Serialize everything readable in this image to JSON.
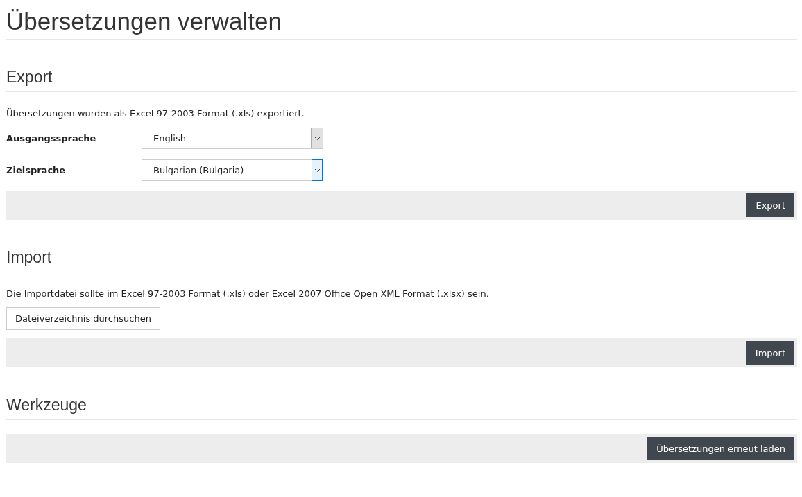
{
  "title": "Übersetzungen verwalten",
  "export": {
    "heading": "Export",
    "note": "Übersetzungen wurden als Excel 97-2003 Format (.xls) exportiert.",
    "fields": [
      {
        "label": "Ausgangssprache",
        "value": "English",
        "focused": false
      },
      {
        "label": "Zielsprache",
        "value": "Bulgarian (Bulgaria)",
        "focused": true
      }
    ],
    "button": "Export"
  },
  "import": {
    "heading": "Import",
    "note": "Die Importdatei sollte im Excel 97-2003 Format (.xls) oder Excel 2007 Office Open XML Format (.xlsx) sein.",
    "browse": "Dateiverzeichnis durchsuchen",
    "button": "Import"
  },
  "tools": {
    "heading": "Werkzeuge",
    "button": "Übersetzungen erneut laden"
  }
}
